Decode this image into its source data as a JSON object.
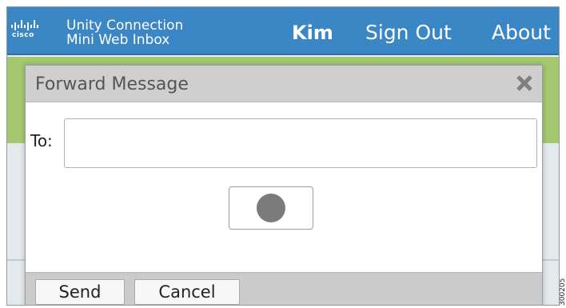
{
  "app": {
    "logo_text": "cisco",
    "title_line1": "Unity Connection",
    "title_line2": "Mini Web Inbox"
  },
  "header": {
    "user_name": "Kim",
    "sign_out_label": "Sign Out",
    "about_label": "About"
  },
  "dialog": {
    "title": "Forward Message",
    "close_icon": "close-x-icon",
    "to_label": "To:",
    "to_value": "",
    "to_placeholder": "",
    "record_icon": "record-dot-icon",
    "send_label": "Send",
    "cancel_label": "Cancel"
  },
  "figure_id": "300205",
  "colors": {
    "topbar": "#3b86c4",
    "band_green": "#a5c86f",
    "dialog_header": "#cfcfcf",
    "footer": "#cbcbcb",
    "record_dot": "#7b7b7b"
  }
}
